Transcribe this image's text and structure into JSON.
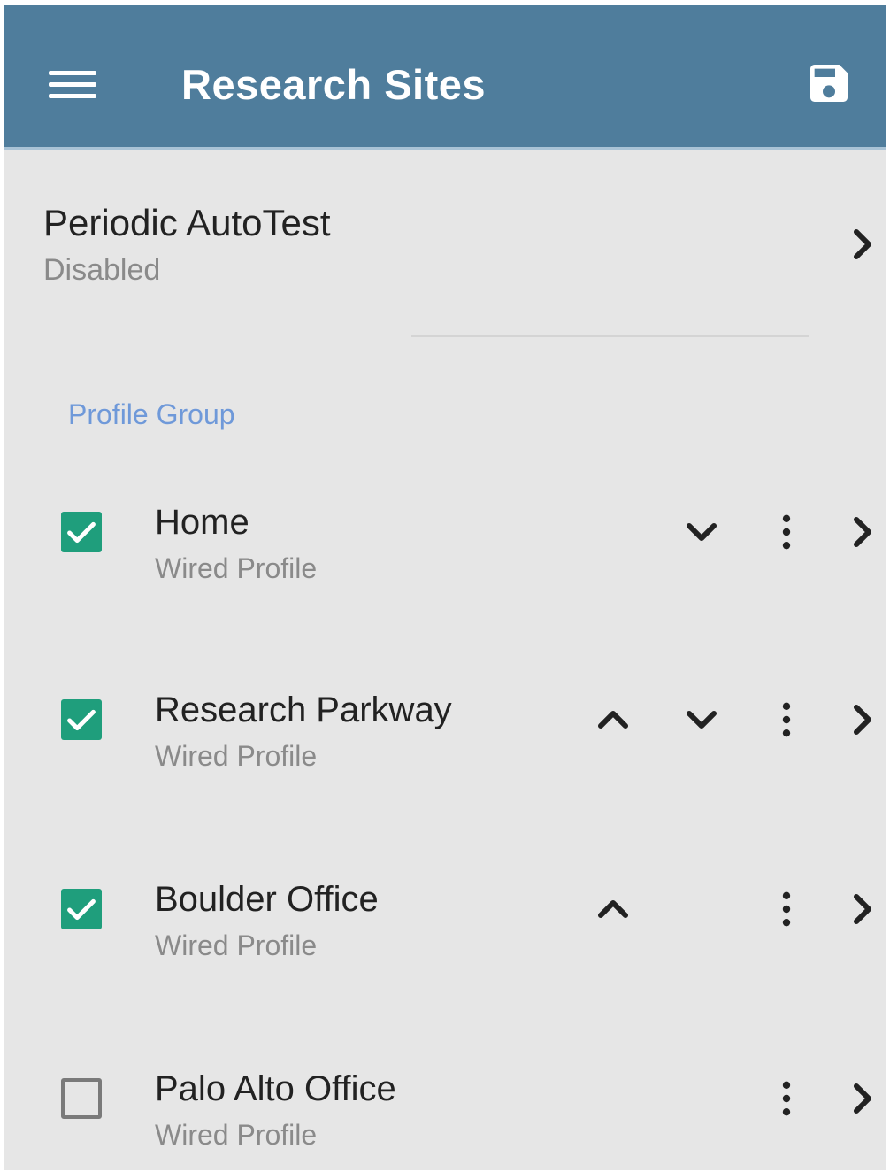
{
  "appbar": {
    "title": "Research Sites",
    "menu_icon": "menu-icon",
    "save_icon": "save-icon",
    "color": "#4f7d9c"
  },
  "periodic_autotest": {
    "title": "Periodic AutoTest",
    "status": "Disabled"
  },
  "profile_group": {
    "header": "Profile Group",
    "header_color": "#6f99d9",
    "check_color": "#1f9e7c",
    "items": [
      {
        "name": "Home",
        "type": "Wired Profile",
        "checked": true,
        "move_up": false,
        "move_down": true
      },
      {
        "name": "Research Parkway",
        "type": "Wired Profile",
        "checked": true,
        "move_up": true,
        "move_down": true
      },
      {
        "name": "Boulder Office",
        "type": "Wired Profile",
        "checked": true,
        "move_up": true,
        "move_down": false
      },
      {
        "name": "Palo Alto Office",
        "type": "Wired Profile",
        "checked": false,
        "move_up": false,
        "move_down": false
      }
    ]
  }
}
